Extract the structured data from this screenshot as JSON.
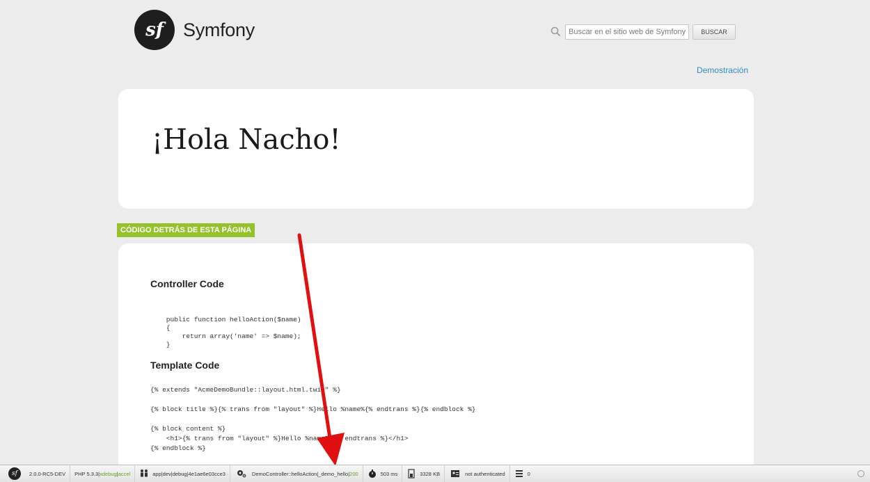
{
  "header": {
    "logo_text": "Symfony",
    "logo_glyph": "sf",
    "search": {
      "placeholder": "Buscar en el sitio web de Symfony",
      "button_label": "BUSCAR"
    },
    "demo_link": "Demostración"
  },
  "hello": {
    "title": "¡Hola Nacho!"
  },
  "code_section": {
    "label": "CÓDIGO DETRÁS DE ESTA PÁGINA",
    "controller_heading": "Controller Code",
    "controller_code": "    public function helloAction($name)\n    {\n        return array('name' => $name);\n    }",
    "template_heading": "Template Code",
    "template_code": "{% extends \"AcmeDemoBundle::layout.html.twig\" %}\n\n{% block title %}{% trans from \"layout\" %}Hello %name%{% endtrans %}{% endblock %}\n\n{% block content %}\n    <h1>{% trans from \"layout\" %}Hello %name%!{% endtrans %}</h1>\n{% endblock %}"
  },
  "toolbar": {
    "version": "2.0.0-RC5-DEV",
    "php_prefix": "PHP 5.3.3",
    "php_ext": "xdebug",
    "php_accel": "accel",
    "env": "app",
    "env_name": "dev",
    "env_debug": "debug",
    "token": "4e1ae6e03cce3",
    "controller": "DemoController::helloAction",
    "route": "_demo_hello",
    "status": "200",
    "time": "503 ms",
    "memory": "3328 KB",
    "auth": "not authenticated",
    "db_queries": "0"
  },
  "colors": {
    "accent_green": "#94c22b",
    "link_blue": "#2d8fc4",
    "arrow_red": "#e01010"
  }
}
